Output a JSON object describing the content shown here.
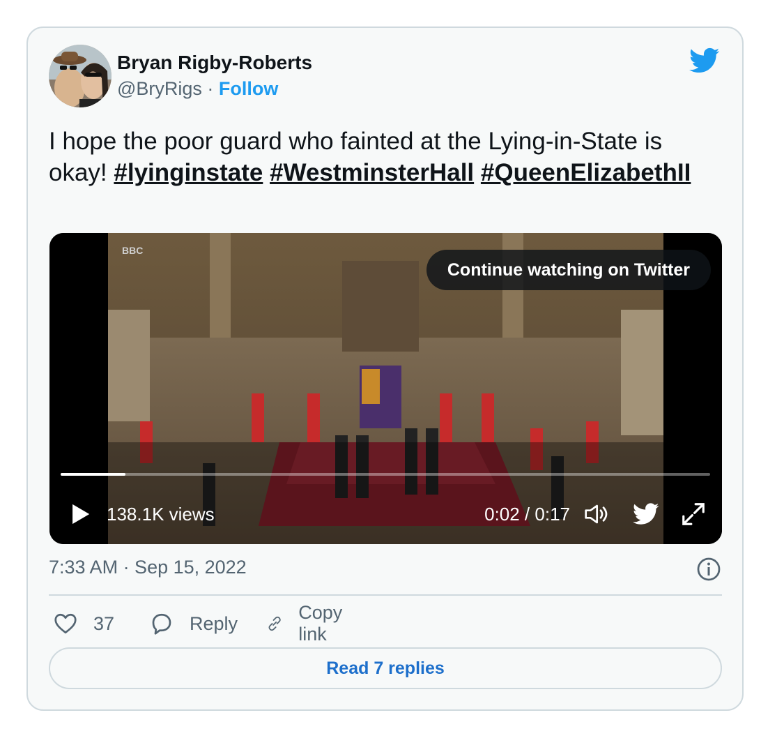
{
  "author": {
    "name": "Bryan Rigby-Roberts",
    "handle": "@BryRigs",
    "separator": " · ",
    "follow_label": "Follow"
  },
  "tweet": {
    "text_plain": "I hope the poor guard who fainted at the Lying-in-State is okay! ",
    "hashtags": [
      "#lyinginstate",
      "#WestminsterHall",
      "#QueenElizabethII"
    ]
  },
  "video": {
    "continue_label": "Continue watching on Twitter",
    "views": "138.1K views",
    "time": "0:02 / 0:17",
    "progress": 0.1,
    "broadcaster_logo": "BBC"
  },
  "meta": {
    "timestamp": "7:33 AM · Sep 15, 2022"
  },
  "actions": {
    "likes": "37",
    "reply_label": "Reply",
    "copy_label": "Copy link"
  },
  "read_replies_label": "Read 7 replies",
  "colors": {
    "accent": "#1d9bf0",
    "text": "#0f1419",
    "muted": "#536471",
    "border": "#cfd9de",
    "card_bg": "#f7f9f9"
  },
  "icons": [
    "twitter-bird-icon",
    "play-icon",
    "volume-icon",
    "fullscreen-icon",
    "info-icon",
    "heart-icon",
    "reply-icon",
    "link-icon"
  ]
}
